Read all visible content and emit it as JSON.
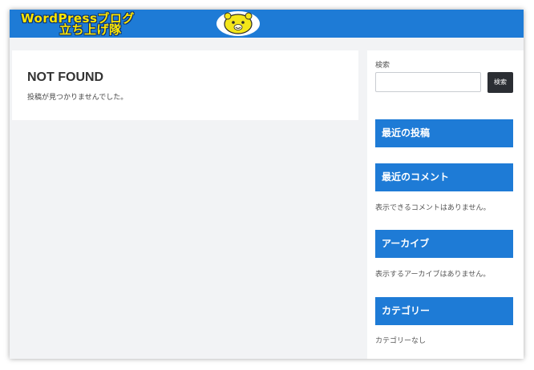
{
  "header": {
    "logo_line1": "WordPressブログ",
    "logo_line2": "立ち上げ隊",
    "bg_color": "#1e7bd6",
    "logo_icon": "bear-mascot-icon"
  },
  "main": {
    "title": "NOT FOUND",
    "message": "投稿が見つかりませんでした。"
  },
  "sidebar": {
    "search_label": "検索",
    "search_placeholder": "",
    "search_button": "検索",
    "widgets": [
      {
        "title": "最近の投稿",
        "text": ""
      },
      {
        "title": "最近のコメント",
        "text": "表示できるコメントはありません。"
      },
      {
        "title": "アーカイブ",
        "text": "表示するアーカイブはありません。"
      },
      {
        "title": "カテゴリー",
        "text": "カテゴリーなし"
      }
    ]
  }
}
